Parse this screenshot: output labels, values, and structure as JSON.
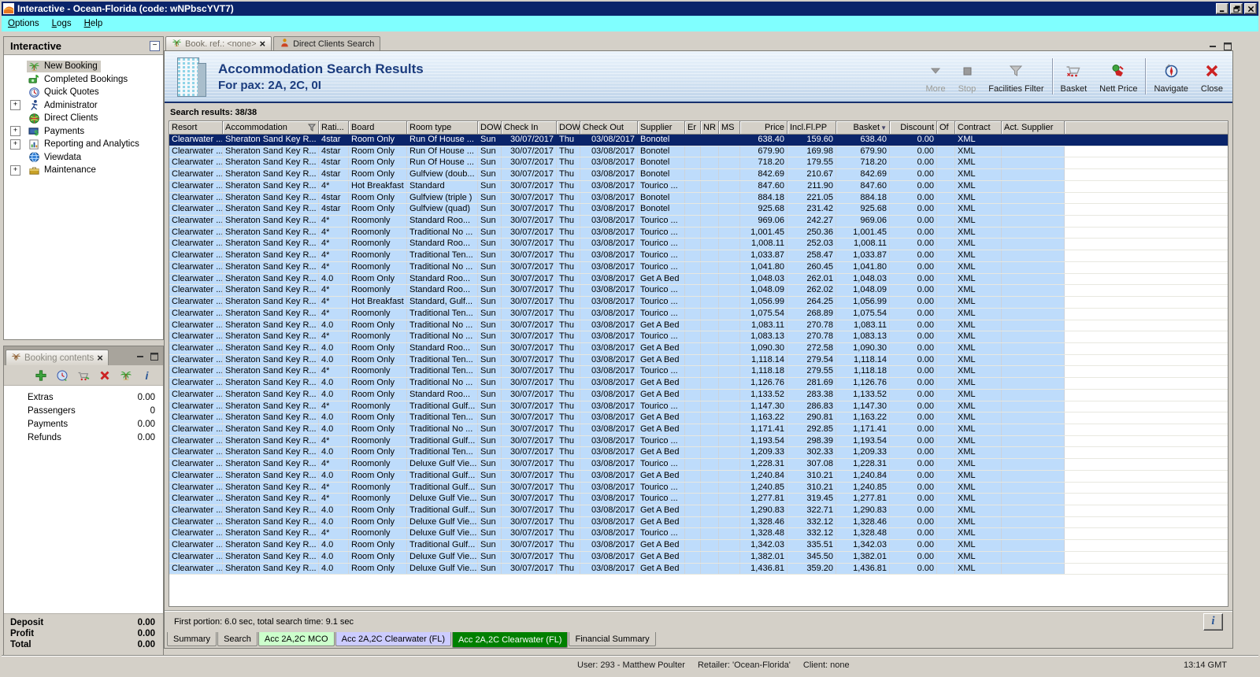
{
  "window": {
    "title": "Interactive - Ocean-Florida (code: wNPbscYVT7)"
  },
  "menu": {
    "items": [
      "Options",
      "Logs",
      "Help"
    ]
  },
  "sidebar": {
    "title": "Interactive",
    "items": [
      {
        "label": "New Booking",
        "icon": "palm-tree-icon",
        "expandable": false,
        "selected": true
      },
      {
        "label": "Completed Bookings",
        "icon": "completed-bookings-icon",
        "expandable": false
      },
      {
        "label": "Quick Quotes",
        "icon": "quick-quotes-icon",
        "expandable": false
      },
      {
        "label": "Administrator",
        "icon": "administrator-icon",
        "expandable": true
      },
      {
        "label": "Direct Clients",
        "icon": "direct-clients-icon",
        "expandable": false
      },
      {
        "label": "Payments",
        "icon": "payments-icon",
        "expandable": true
      },
      {
        "label": "Reporting and Analytics",
        "icon": "reporting-icon",
        "expandable": true
      },
      {
        "label": "Viewdata",
        "icon": "viewdata-icon",
        "expandable": false
      },
      {
        "label": "Maintenance",
        "icon": "maintenance-icon",
        "expandable": true
      }
    ]
  },
  "booking_contents": {
    "title": "Booking contents",
    "toolbar": [
      {
        "icon": "add-icon"
      },
      {
        "icon": "quick-quote-icon"
      },
      {
        "icon": "add-to-basket-icon"
      },
      {
        "icon": "delete-icon"
      },
      {
        "icon": "holiday-icon"
      },
      {
        "icon": "info-icon"
      }
    ],
    "rows": [
      {
        "label": "Extras",
        "value": "0.00"
      },
      {
        "label": "Passengers",
        "value": "0"
      },
      {
        "label": "Payments",
        "value": "0.00"
      },
      {
        "label": "Refunds",
        "value": "0.00"
      }
    ],
    "totals": [
      {
        "label": "Deposit",
        "value": "0.00"
      },
      {
        "label": "Profit",
        "value": "0.00"
      },
      {
        "label": "Total",
        "value": "0.00"
      }
    ]
  },
  "main": {
    "tabs": [
      {
        "label": "Book. ref.: <none>",
        "icon": "palm-tree-icon",
        "closable": true,
        "active": true
      },
      {
        "label": "Direct Clients Search",
        "icon": "person-icon",
        "closable": false,
        "active": false
      }
    ],
    "header": {
      "title": "Accommodation Search Results",
      "subtitle": "For pax: 2A, 2C, 0I"
    },
    "toolbar": [
      {
        "label": "More",
        "icon": "more-icon",
        "disabled": true
      },
      {
        "label": "Stop",
        "icon": "stop-icon",
        "disabled": true
      },
      {
        "label": "Facilities Filter",
        "icon": "filter-icon",
        "disabled": false
      },
      {
        "separator": true
      },
      {
        "label": "Basket",
        "icon": "basket-icon",
        "disabled": false
      },
      {
        "label": "Nett Price",
        "icon": "nett-price-icon",
        "disabled": false
      },
      {
        "separator": true
      },
      {
        "label": "Navigate",
        "icon": "navigate-icon",
        "disabled": false
      },
      {
        "label": "Close",
        "icon": "close-icon",
        "disabled": false
      }
    ],
    "results_label": "Search results: 38/38",
    "status_text": "First portion: 6.0 sec, total search time: 9.1 sec",
    "info_button": "i",
    "bottom_tabs": [
      {
        "label": "Summary"
      },
      {
        "label": "Search"
      },
      {
        "label": "Acc 2A,2C MCO",
        "bg": "#CCFFCC"
      },
      {
        "label": "Acc 2A,2C Clearwater (FL)",
        "bg": "#CCCCFF"
      },
      {
        "label": "Acc 2A,2C Clearwater (FL)",
        "bg": "#008000",
        "fg": "#FFFFFF",
        "active": true
      },
      {
        "label": "Financial Summary"
      }
    ],
    "table": {
      "columns": [
        {
          "label": "Resort"
        },
        {
          "label": "Accommodation",
          "filter_icon": true
        },
        {
          "label": "Rati..."
        },
        {
          "label": "Board"
        },
        {
          "label": "Room type"
        },
        {
          "label": "DOW"
        },
        {
          "label": "Check In"
        },
        {
          "label": "DOW"
        },
        {
          "label": "Check Out"
        },
        {
          "label": "Supplier"
        },
        {
          "label": "Er"
        },
        {
          "label": "NR"
        },
        {
          "label": "MS"
        },
        {
          "label": "Price"
        },
        {
          "label": "Incl.Fl.PP"
        },
        {
          "label": "Basket",
          "sort_icon": true
        },
        {
          "label": "Discount"
        },
        {
          "label": "Of"
        },
        {
          "label": "Contract"
        },
        {
          "label": "Act. Supplier"
        }
      ],
      "fields": [
        "resort",
        "accommodation",
        "rating",
        "board",
        "room_type",
        "dow_in",
        "check_in",
        "dow_out",
        "check_out",
        "supplier",
        "er",
        "nr",
        "ms",
        "price",
        "incl_fl_pp",
        "basket",
        "discount",
        "of",
        "contract",
        "act_supplier"
      ],
      "row_defaults": {
        "resort": "Clearwater ...",
        "accommodation": "Sheraton Sand Key R...",
        "dow_in": "Sun",
        "check_in": "30/07/2017",
        "dow_out": "Thu",
        "check_out": "03/08/2017",
        "er": "",
        "nr": "",
        "ms": "",
        "discount": "0.00",
        "of": "",
        "contract": "XML",
        "act_supplier": ""
      },
      "selected_row": 0,
      "rows": [
        {
          "rating": "4star",
          "board": "Room Only",
          "room_type": "Run Of House ...",
          "supplier": "Bonotel",
          "price": "638.40",
          "incl_fl_pp": "159.60",
          "basket": "638.40"
        },
        {
          "rating": "4star",
          "board": "Room Only",
          "room_type": "Run Of House ...",
          "supplier": "Bonotel",
          "price": "679.90",
          "incl_fl_pp": "169.98",
          "basket": "679.90"
        },
        {
          "rating": "4star",
          "board": "Room Only",
          "room_type": "Run Of House ...",
          "supplier": "Bonotel",
          "price": "718.20",
          "incl_fl_pp": "179.55",
          "basket": "718.20"
        },
        {
          "rating": "4star",
          "board": "Room Only",
          "room_type": "Gulfview (doub...",
          "supplier": "Bonotel",
          "price": "842.69",
          "incl_fl_pp": "210.67",
          "basket": "842.69"
        },
        {
          "rating": "4*",
          "board": "Hot Breakfast",
          "room_type": "Standard",
          "supplier": "Tourico ...",
          "price": "847.60",
          "incl_fl_pp": "211.90",
          "basket": "847.60"
        },
        {
          "rating": "4star",
          "board": "Room Only",
          "room_type": "Gulfview (triple )",
          "supplier": "Bonotel",
          "price": "884.18",
          "incl_fl_pp": "221.05",
          "basket": "884.18"
        },
        {
          "rating": "4star",
          "board": "Room Only",
          "room_type": "Gulfview (quad)",
          "supplier": "Bonotel",
          "price": "925.68",
          "incl_fl_pp": "231.42",
          "basket": "925.68"
        },
        {
          "rating": "4*",
          "board": "Roomonly",
          "room_type": "Standard Roo...",
          "supplier": "Tourico ...",
          "price": "969.06",
          "incl_fl_pp": "242.27",
          "basket": "969.06"
        },
        {
          "rating": "4*",
          "board": "Roomonly",
          "room_type": "Traditional No ...",
          "supplier": "Tourico ...",
          "price": "1,001.45",
          "incl_fl_pp": "250.36",
          "basket": "1,001.45"
        },
        {
          "rating": "4*",
          "board": "Roomonly",
          "room_type": "Standard Roo...",
          "supplier": "Tourico ...",
          "price": "1,008.11",
          "incl_fl_pp": "252.03",
          "basket": "1,008.11"
        },
        {
          "rating": "4*",
          "board": "Roomonly",
          "room_type": "Traditional Ten...",
          "supplier": "Tourico ...",
          "price": "1,033.87",
          "incl_fl_pp": "258.47",
          "basket": "1,033.87"
        },
        {
          "rating": "4*",
          "board": "Roomonly",
          "room_type": "Traditional No ...",
          "supplier": "Tourico ...",
          "price": "1,041.80",
          "incl_fl_pp": "260.45",
          "basket": "1,041.80"
        },
        {
          "rating": "4.0",
          "board": "Room Only",
          "room_type": "Standard Roo...",
          "supplier": "Get A Bed",
          "price": "1,048.03",
          "incl_fl_pp": "262.01",
          "basket": "1,048.03"
        },
        {
          "rating": "4*",
          "board": "Roomonly",
          "room_type": "Standard Roo...",
          "supplier": "Tourico ...",
          "price": "1,048.09",
          "incl_fl_pp": "262.02",
          "basket": "1,048.09"
        },
        {
          "rating": "4*",
          "board": "Hot Breakfast",
          "room_type": "Standard, Gulf...",
          "supplier": "Tourico ...",
          "price": "1,056.99",
          "incl_fl_pp": "264.25",
          "basket": "1,056.99"
        },
        {
          "rating": "4*",
          "board": "Roomonly",
          "room_type": "Traditional Ten...",
          "supplier": "Tourico ...",
          "price": "1,075.54",
          "incl_fl_pp": "268.89",
          "basket": "1,075.54"
        },
        {
          "rating": "4.0",
          "board": "Room Only",
          "room_type": "Traditional No ...",
          "supplier": "Get A Bed",
          "price": "1,083.11",
          "incl_fl_pp": "270.78",
          "basket": "1,083.11"
        },
        {
          "rating": "4*",
          "board": "Roomonly",
          "room_type": "Traditional No ...",
          "supplier": "Tourico ...",
          "price": "1,083.13",
          "incl_fl_pp": "270.78",
          "basket": "1,083.13"
        },
        {
          "rating": "4.0",
          "board": "Room Only",
          "room_type": "Standard Roo...",
          "supplier": "Get A Bed",
          "price": "1,090.30",
          "incl_fl_pp": "272.58",
          "basket": "1,090.30"
        },
        {
          "rating": "4.0",
          "board": "Room Only",
          "room_type": "Traditional Ten...",
          "supplier": "Get A Bed",
          "price": "1,118.14",
          "incl_fl_pp": "279.54",
          "basket": "1,118.14"
        },
        {
          "rating": "4*",
          "board": "Roomonly",
          "room_type": "Traditional Ten...",
          "supplier": "Tourico ...",
          "price": "1,118.18",
          "incl_fl_pp": "279.55",
          "basket": "1,118.18"
        },
        {
          "rating": "4.0",
          "board": "Room Only",
          "room_type": "Traditional No ...",
          "supplier": "Get A Bed",
          "price": "1,126.76",
          "incl_fl_pp": "281.69",
          "basket": "1,126.76"
        },
        {
          "rating": "4.0",
          "board": "Room Only",
          "room_type": "Standard Roo...",
          "supplier": "Get A Bed",
          "price": "1,133.52",
          "incl_fl_pp": "283.38",
          "basket": "1,133.52"
        },
        {
          "rating": "4*",
          "board": "Roomonly",
          "room_type": "Traditional Gulf...",
          "supplier": "Tourico ...",
          "price": "1,147.30",
          "incl_fl_pp": "286.83",
          "basket": "1,147.30"
        },
        {
          "rating": "4.0",
          "board": "Room Only",
          "room_type": "Traditional Ten...",
          "supplier": "Get A Bed",
          "price": "1,163.22",
          "incl_fl_pp": "290.81",
          "basket": "1,163.22"
        },
        {
          "rating": "4.0",
          "board": "Room Only",
          "room_type": "Traditional No ...",
          "supplier": "Get A Bed",
          "price": "1,171.41",
          "incl_fl_pp": "292.85",
          "basket": "1,171.41"
        },
        {
          "rating": "4*",
          "board": "Roomonly",
          "room_type": "Traditional Gulf...",
          "supplier": "Tourico ...",
          "price": "1,193.54",
          "incl_fl_pp": "298.39",
          "basket": "1,193.54"
        },
        {
          "rating": "4.0",
          "board": "Room Only",
          "room_type": "Traditional Ten...",
          "supplier": "Get A Bed",
          "price": "1,209.33",
          "incl_fl_pp": "302.33",
          "basket": "1,209.33"
        },
        {
          "rating": "4*",
          "board": "Roomonly",
          "room_type": "Deluxe Gulf Vie...",
          "supplier": "Tourico ...",
          "price": "1,228.31",
          "incl_fl_pp": "307.08",
          "basket": "1,228.31"
        },
        {
          "rating": "4.0",
          "board": "Room Only",
          "room_type": "Traditional Gulf...",
          "supplier": "Get A Bed",
          "price": "1,240.84",
          "incl_fl_pp": "310.21",
          "basket": "1,240.84"
        },
        {
          "rating": "4*",
          "board": "Roomonly",
          "room_type": "Traditional Gulf...",
          "supplier": "Tourico ...",
          "price": "1,240.85",
          "incl_fl_pp": "310.21",
          "basket": "1,240.85"
        },
        {
          "rating": "4*",
          "board": "Roomonly",
          "room_type": "Deluxe Gulf Vie...",
          "supplier": "Tourico ...",
          "price": "1,277.81",
          "incl_fl_pp": "319.45",
          "basket": "1,277.81"
        },
        {
          "rating": "4.0",
          "board": "Room Only",
          "room_type": "Traditional Gulf...",
          "supplier": "Get A Bed",
          "price": "1,290.83",
          "incl_fl_pp": "322.71",
          "basket": "1,290.83"
        },
        {
          "rating": "4.0",
          "board": "Room Only",
          "room_type": "Deluxe Gulf Vie...",
          "supplier": "Get A Bed",
          "price": "1,328.46",
          "incl_fl_pp": "332.12",
          "basket": "1,328.46"
        },
        {
          "rating": "4*",
          "board": "Roomonly",
          "room_type": "Deluxe Gulf Vie...",
          "supplier": "Tourico ...",
          "price": "1,328.48",
          "incl_fl_pp": "332.12",
          "basket": "1,328.48"
        },
        {
          "rating": "4.0",
          "board": "Room Only",
          "room_type": "Traditional Gulf...",
          "supplier": "Get A Bed",
          "price": "1,342.03",
          "incl_fl_pp": "335.51",
          "basket": "1,342.03"
        },
        {
          "rating": "4.0",
          "board": "Room Only",
          "room_type": "Deluxe Gulf Vie...",
          "supplier": "Get A Bed",
          "price": "1,382.01",
          "incl_fl_pp": "345.50",
          "basket": "1,382.01"
        },
        {
          "rating": "4.0",
          "board": "Room Only",
          "room_type": "Deluxe Gulf Vie...",
          "supplier": "Get A Bed",
          "price": "1,436.81",
          "incl_fl_pp": "359.20",
          "basket": "1,436.81"
        }
      ]
    }
  },
  "statusbar": {
    "user": "User: 293 - Matthew Poulter",
    "retailer": "Retailer: 'Ocean-Florida'",
    "client": "Client: none",
    "time": "13:14 GMT"
  }
}
